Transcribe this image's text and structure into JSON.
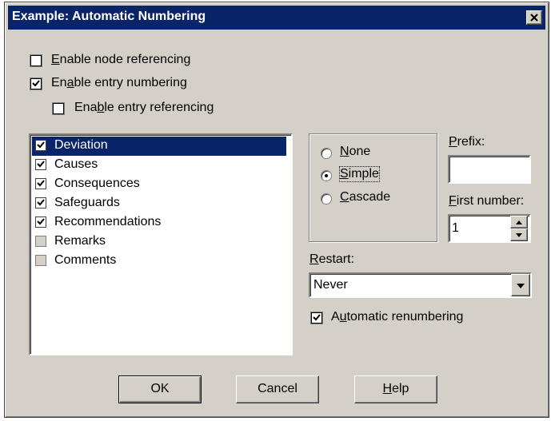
{
  "window": {
    "title": "Example: Automatic Numbering"
  },
  "options": {
    "enable_node_referencing": {
      "label_pre": "",
      "label_ul": "E",
      "label_post": "nable node referencing",
      "checked": false
    },
    "enable_entry_numbering": {
      "label_pre": "En",
      "label_ul": "a",
      "label_post": "ble entry numbering",
      "checked": true
    },
    "enable_entry_referencing": {
      "label_pre": "Ena",
      "label_ul": "b",
      "label_post": "le entry referencing",
      "checked": false
    }
  },
  "entry_list": [
    {
      "label": "Deviation",
      "checked": true,
      "selected": true
    },
    {
      "label": "Causes",
      "checked": true,
      "selected": false
    },
    {
      "label": "Consequences",
      "checked": true,
      "selected": false
    },
    {
      "label": "Safeguards",
      "checked": true,
      "selected": false
    },
    {
      "label": "Recommendations",
      "checked": true,
      "selected": false
    },
    {
      "label": "Remarks",
      "checked": false,
      "selected": false
    },
    {
      "label": "Comments",
      "checked": false,
      "selected": false
    }
  ],
  "numbering_style": {
    "selected": "Simple",
    "none": {
      "label_ul": "N",
      "label_post": "one"
    },
    "simple": {
      "label_ul": "S",
      "label_post": "imple"
    },
    "cascade": {
      "label_ul": "C",
      "label_post": "ascade"
    }
  },
  "prefix": {
    "label_ul": "P",
    "label_post": "refix:",
    "value": ""
  },
  "first_number": {
    "label_ul": "F",
    "label_post": "irst number:",
    "value": "1"
  },
  "restart": {
    "label_ul": "R",
    "label_post": "estart:",
    "value": "Never"
  },
  "automatic_renumbering": {
    "label_pre": "A",
    "label_ul": "u",
    "label_post": "tomatic renumbering",
    "checked": true
  },
  "buttons": {
    "ok": "OK",
    "cancel": "Cancel",
    "help_ul": "H",
    "help_post": "elp"
  },
  "icons": {
    "close": "close-icon",
    "check": "checkmark-icon",
    "dropdown": "chevron-down-icon",
    "spin_up": "spin-up-icon",
    "spin_down": "spin-down-icon"
  }
}
